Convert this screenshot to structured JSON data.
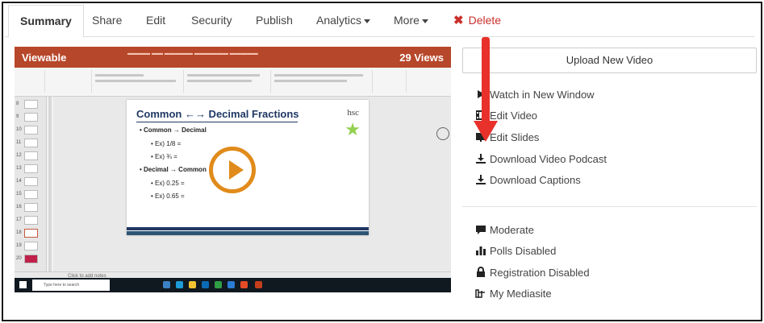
{
  "tabs": [
    {
      "label": "Summary"
    },
    {
      "label": "Share"
    },
    {
      "label": "Edit"
    },
    {
      "label": "Security"
    },
    {
      "label": "Publish"
    },
    {
      "label": "Analytics"
    },
    {
      "label": "More"
    },
    {
      "label": "Delete"
    }
  ],
  "video": {
    "status_label": "Viewable",
    "views_label": "29 Views",
    "slide": {
      "title": "Common ←→ Decimal Fractions",
      "logo_text": "hsc",
      "bullets": [
        "Common → Decimal",
        "Ex) 1/8 =",
        "Ex) ¾ =",
        "Decimal → Common",
        "Ex) 0.25 =",
        "Ex) 0.65 ="
      ]
    },
    "notes_placeholder": "Click to add notes",
    "taskbar_search": "Type here to search"
  },
  "upload_button": "Upload New Video",
  "actions_primary": [
    {
      "label": "Watch in New Window",
      "icon": "play-icon"
    },
    {
      "label": "Edit Video",
      "icon": "film-icon"
    },
    {
      "label": "Edit Slides",
      "icon": "slides-icon"
    },
    {
      "label": "Download Video Podcast",
      "icon": "download-icon"
    },
    {
      "label": "Download Captions",
      "icon": "download-icon"
    }
  ],
  "actions_secondary": [
    {
      "label": "Moderate",
      "icon": "comment-icon"
    },
    {
      "label": "Polls Disabled",
      "icon": "bar-chart-icon"
    },
    {
      "label": "Registration Disabled",
      "icon": "lock-icon"
    },
    {
      "label": "My Mediasite",
      "icon": "pointer-hand-icon"
    }
  ],
  "colors": {
    "delete": "#c9302c",
    "play_accent": "#e08b1b",
    "annotation_arrow": "#e8312a",
    "ppt_titlebar": "#b7472a"
  }
}
